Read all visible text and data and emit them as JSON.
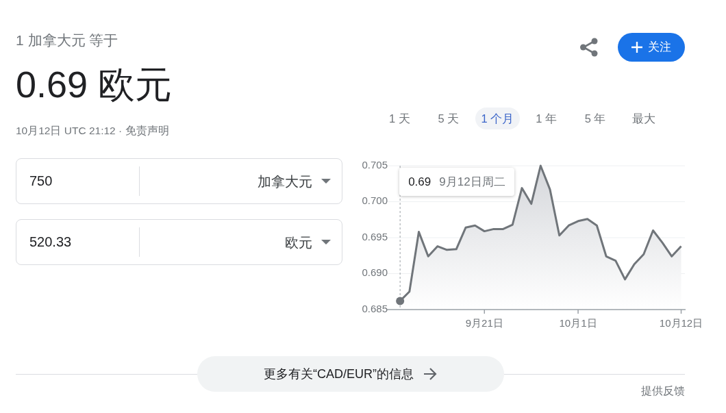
{
  "header": {
    "subtitle": "1 加拿大元 等于",
    "rate": "0.69 欧元",
    "timestamp": "10月12日 UTC 21:12 ·",
    "disclaimer_link": "免责声明"
  },
  "follow_button": {
    "label": "关注"
  },
  "ranges": [
    {
      "label": "1 天",
      "selected": false
    },
    {
      "label": "5 天",
      "selected": false
    },
    {
      "label": "1 个月",
      "selected": true
    },
    {
      "label": "1 年",
      "selected": false
    },
    {
      "label": "5 年",
      "selected": false
    },
    {
      "label": "最大",
      "selected": false
    }
  ],
  "converter": [
    {
      "value": "750",
      "currency": "加拿大元"
    },
    {
      "value": "520.33",
      "currency": "欧元"
    }
  ],
  "chart": {
    "tooltip": {
      "value": "0.69",
      "date": "9月12日周二"
    },
    "chart_data": {
      "type": "area",
      "categories": [
        null,
        null,
        null,
        null,
        null,
        null,
        null,
        null,
        null,
        "9月21日",
        null,
        null,
        null,
        null,
        null,
        null,
        null,
        null,
        null,
        "10月1日",
        null,
        null,
        null,
        null,
        null,
        null,
        null,
        null,
        null,
        null,
        "10月12日"
      ],
      "values": [
        0.6862,
        0.6875,
        0.6958,
        0.6924,
        0.6938,
        0.6933,
        0.6934,
        0.6964,
        0.6967,
        0.6959,
        0.6962,
        0.6962,
        0.6968,
        0.7019,
        0.6997,
        0.705,
        0.7017,
        0.6953,
        0.6967,
        0.6973,
        0.6976,
        0.6967,
        0.6924,
        0.6918,
        0.6892,
        0.6913,
        0.6927,
        0.696,
        0.6943,
        0.6924,
        0.6938
      ],
      "ylim": [
        0.685,
        0.705
      ],
      "grid": true,
      "yticks": [
        {
          "value": 0.685,
          "label": "0.685"
        },
        {
          "value": 0.69,
          "label": "0.690"
        },
        {
          "value": 0.695,
          "label": "0.695"
        },
        {
          "value": 0.7,
          "label": "0.700"
        },
        {
          "value": 0.705,
          "label": "0.705"
        }
      ]
    }
  },
  "more_info_button": {
    "label": "更多有关“CAD/EUR”的信息"
  },
  "feedback_link": "提供反馈"
}
